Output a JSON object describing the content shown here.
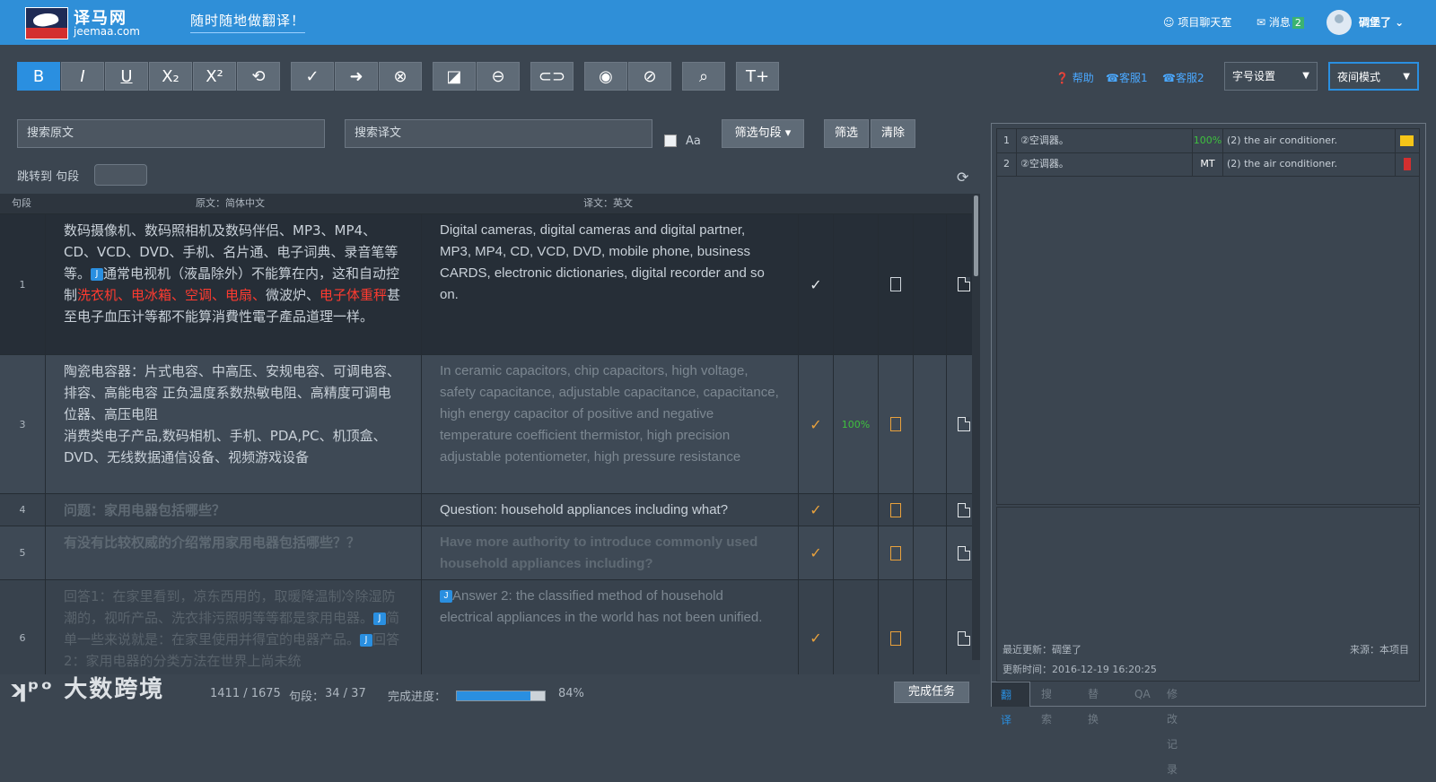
{
  "header": {
    "brand_cn": "译马网",
    "brand_en": "jeemaa.com",
    "slogan": "随时随地做翻译！",
    "chat": "项目聊天室",
    "messages": "消息",
    "messages_count": "2",
    "user": "碉堡了 ⌄"
  },
  "toolbar": {
    "buttons": [
      "B",
      "I",
      "U",
      "X₂",
      "X²",
      "⟲",
      "✓",
      "➜",
      "⊗",
      "◪",
      "⊖",
      "⊂⊃",
      "◉",
      "⊘",
      "⌕",
      "T+"
    ],
    "help": "帮助",
    "service1": "客服1",
    "service2": "客服2",
    "font_setting": "字号设置",
    "night_mode": "夜间模式"
  },
  "search": {
    "source_placeholder": "搜索原文",
    "target_placeholder": "搜索译文",
    "case_label": "Aa",
    "filter_segments": "筛选句段 ▾",
    "filter": "筛选",
    "clear": "清除"
  },
  "jump": {
    "label": "跳转到 句段"
  },
  "table": {
    "headers": {
      "segment": "句段",
      "source": "原文：简体中文",
      "target": "译文：英文"
    },
    "rows": [
      {
        "seg": "1",
        "src_a": "数码摄像机、数码照相机及数码伴侣、MP3、MP4、CD、VCD、DVD、手机、名片通、电子词典、录音笔等等。",
        "src_b": "通常电视机（液晶除外）不能算在内，这和自动控制",
        "src_red1": "洗衣机、电冰箱、空调、电扇、",
        "src_c": "微波炉、",
        "src_red2": "电子体重秤",
        "src_d": "甚至电子血压计等都不能算消費性電子產品道理一样。",
        "tgt": "Digital cameras, digital cameras and digital partner, MP3, MP4, CD, VCD, DVD, mobile phone, business CARDS, electronic dictionaries, digital recorder and so on.",
        "match": ""
      },
      {
        "seg": "3",
        "src_a": "陶瓷电容器：片式电容、中高压、安规电容、可调电容、排容、高能电容 正负温度系数热敏电阻、高精度可调电位器、高压电阻",
        "src_b": "消费类电子产品,数码相机、手机、PDA,PC、机顶盒、DVD、无线数据通信设备、视频游戏设备",
        "tgt": "In ceramic capacitors, chip capacitors, high voltage, safety capacitance, adjustable capacitance, capacitance, high energy capacitor of positive and negative temperature coefficient thermistor, high precision adjustable potentiometer, high pressure resistance",
        "match": "100%"
      },
      {
        "seg": "4",
        "src": "问题：家用电器包括哪些？",
        "tgt": "Question: household appliances including what?"
      },
      {
        "seg": "5",
        "src": "有没有比较权威的介绍常用家用电器包括哪些？？",
        "tgt": "Have more authority to introduce commonly used household appliances including?"
      },
      {
        "seg": "6",
        "src_a": "回答1：在家里看到，凉东西用的，取暖降温制冷除湿防潮的，视听产品、洗衣排污照明等等都是家用电器。",
        "src_b": "简单一些来说就是：在家里使用并得宜的电器产品。",
        "src_c": "回答2：家用电器的分类方法在世界上尚未统",
        "tgt": "Answer 2: the classified method of household electrical appliances in the world has not been unified."
      }
    ]
  },
  "footer": {
    "words": "1411 / 1675",
    "segments_label": "句段：",
    "segments": "34 / 37",
    "progress_label": "完成进度：",
    "progress_value": 0.84,
    "progress_text": "84%",
    "done": "完成任务"
  },
  "watermark": "大数跨境",
  "tm": {
    "rows": [
      {
        "n": "1",
        "src": "②空调器。",
        "score": "100%",
        "tgt": "(2) the air conditioner."
      },
      {
        "n": "2",
        "src": "②空调器。",
        "score": "MT",
        "tgt": "(2) the air conditioner."
      }
    ],
    "last_update": "最近更新：碉堡了",
    "source": "来源：本项目",
    "update_time": "更新时间：2016-12-19 16:20:25"
  },
  "right_tabs": [
    "翻译",
    "搜索",
    "替换",
    "QA",
    "修改记录"
  ],
  "colors": {
    "accent": "#2a8fe0",
    "highlight": "#ff3b30",
    "match": "#3ec03e",
    "note": "#e8a13c"
  }
}
